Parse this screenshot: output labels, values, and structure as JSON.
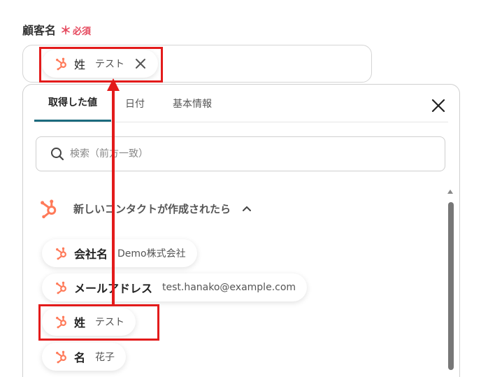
{
  "field": {
    "label": "顧客名",
    "required_mark": "＊",
    "required_text": "必須",
    "selected_chip": {
      "key": "姓",
      "value": "テスト"
    }
  },
  "panel": {
    "tabs": [
      {
        "label": "取得した値",
        "active": true
      },
      {
        "label": "日付",
        "active": false
      },
      {
        "label": "基本情報",
        "active": false
      }
    ],
    "search_placeholder": "検索（前方一致）",
    "group": {
      "title": "新しいコンタクトが作成されたら",
      "items": [
        {
          "key": "会社名",
          "value": "Demo株式会社"
        },
        {
          "key": "メールアドレス",
          "value": "test.hanako@example.com"
        },
        {
          "key": "姓",
          "value": "テスト"
        },
        {
          "key": "名",
          "value": "花子"
        }
      ]
    }
  },
  "colors": {
    "hubspot_orange": "#ff7a59",
    "required_red": "#e5485d",
    "active_tab_underline": "#1c6b7e",
    "annotation_red": "#e31b1b"
  },
  "icons": {
    "source": "hubspot-icon",
    "remove": "close-icon",
    "panel_close": "close-icon",
    "search": "search-icon",
    "collapse": "chevron-up-icon"
  }
}
